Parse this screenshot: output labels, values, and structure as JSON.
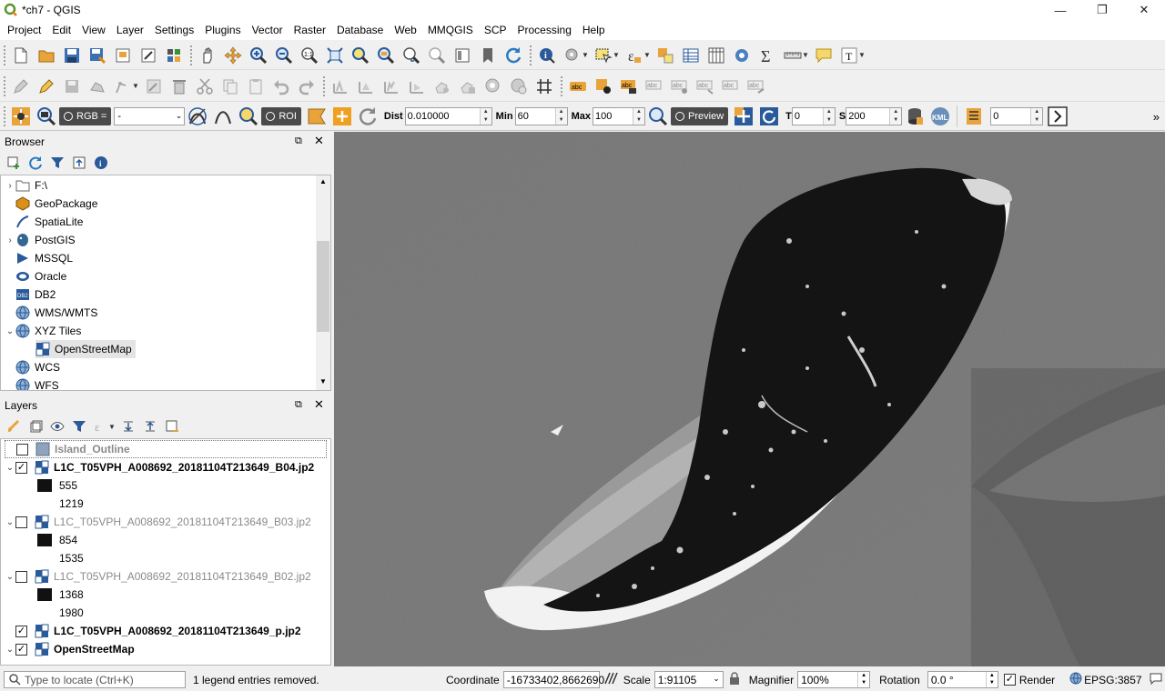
{
  "window": {
    "title": "*ch7 - QGIS"
  },
  "menu": [
    "Project",
    "Edit",
    "View",
    "Layer",
    "Settings",
    "Plugins",
    "Vector",
    "Raster",
    "Database",
    "Web",
    "MMQGIS",
    "SCP",
    "Processing",
    "Help"
  ],
  "scp_toolbar": {
    "rgb_label": "RGB =",
    "rgb_value": "-",
    "roi_label": "ROI",
    "dist_label": "Dist",
    "dist_value": "0.010000",
    "min_label": "Min",
    "min_value": "60",
    "max_label": "Max",
    "max_value": "100",
    "preview_label": "Preview",
    "t_label": "T",
    "t_value": "0",
    "s_label": "S",
    "s_value": "200",
    "kml_label": "KML",
    "band_value": "0"
  },
  "browser": {
    "title": "Browser",
    "items": [
      {
        "label": "F:\\",
        "arrow": "›",
        "icon": "folder-icon"
      },
      {
        "label": "GeoPackage",
        "arrow": "",
        "icon": "geopackage-icon"
      },
      {
        "label": "SpatiaLite",
        "arrow": "",
        "icon": "spatialite-icon"
      },
      {
        "label": "PostGIS",
        "arrow": "›",
        "icon": "postgis-icon"
      },
      {
        "label": "MSSQL",
        "arrow": "",
        "icon": "mssql-icon"
      },
      {
        "label": "Oracle",
        "arrow": "",
        "icon": "oracle-icon"
      },
      {
        "label": "DB2",
        "arrow": "",
        "icon": "db2-icon"
      },
      {
        "label": "WMS/WMTS",
        "arrow": "",
        "icon": "globe-icon"
      },
      {
        "label": "XYZ Tiles",
        "arrow": "⌄",
        "icon": "globe-icon"
      },
      {
        "label": "OpenStreetMap",
        "arrow": "",
        "icon": "tiles-icon"
      },
      {
        "label": "WCS",
        "arrow": "",
        "icon": "globe-icon"
      },
      {
        "label": "WFS",
        "arrow": "",
        "icon": "globe-icon"
      }
    ]
  },
  "layers": {
    "title": "Layers",
    "items": [
      {
        "label": "Island_Outline"
      },
      {
        "label": "L1C_T05VPH_A008692_20181104T213649_B04.jp2"
      },
      {
        "label": "555"
      },
      {
        "label": "1219"
      },
      {
        "label": "L1C_T05VPH_A008692_20181104T213649_B03.jp2"
      },
      {
        "label": "854"
      },
      {
        "label": "1535"
      },
      {
        "label": "L1C_T05VPH_A008692_20181104T213649_B02.jp2"
      },
      {
        "label": "1368"
      },
      {
        "label": "1980"
      },
      {
        "label": "L1C_T05VPH_A008692_20181104T213649_p.jp2"
      },
      {
        "label": "OpenStreetMap"
      }
    ]
  },
  "status": {
    "locate_placeholder": "Type to locate (Ctrl+K)",
    "message": "1 legend entries removed.",
    "coordinate_label": "Coordinate",
    "coordinate_value": "-16733402,8662690",
    "scale_label": "Scale",
    "scale_value": "1:91105",
    "magnifier_label": "Magnifier",
    "magnifier_value": "100%",
    "rotation_label": "Rotation",
    "rotation_value": "0.0 °",
    "render_label": "Render",
    "crs_label": "EPSG:3857"
  }
}
